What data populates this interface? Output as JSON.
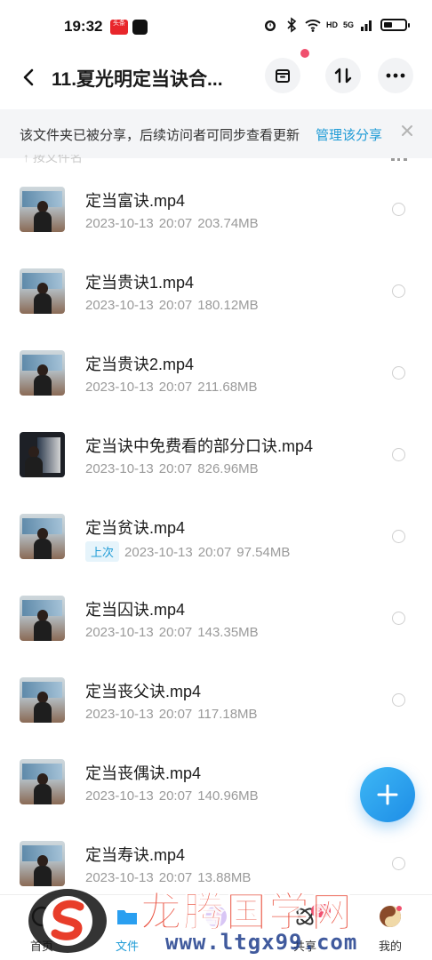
{
  "status_bar": {
    "time": "19:32",
    "app_badge": "头条",
    "network_label": "5G",
    "hd_label": "HD"
  },
  "header": {
    "title": "11.夏光明定当诀合...",
    "back_icon": "arrow-left-icon",
    "actions": [
      {
        "name": "archive-button",
        "icon": "archive-icon"
      },
      {
        "name": "sort-button",
        "icon": "sort-icon"
      },
      {
        "name": "more-button",
        "icon": "more-horizontal-icon"
      }
    ]
  },
  "share_notice": {
    "text": "该文件夹已被分享，后续访问者可同步查看更新",
    "link": "管理该分享",
    "close_icon": "close-icon"
  },
  "sort_hint": "↑ 按文件名",
  "files": [
    {
      "name": "定当富诀.mp4",
      "date": "2023-10-13",
      "time": "20:07",
      "size": "203.74MB",
      "tag": ""
    },
    {
      "name": "定当贵诀1.mp4",
      "date": "2023-10-13",
      "time": "20:07",
      "size": "180.12MB",
      "tag": ""
    },
    {
      "name": "定当贵诀2.mp4",
      "date": "2023-10-13",
      "time": "20:07",
      "size": "211.68MB",
      "tag": ""
    },
    {
      "name": "定当诀中免费看的部分口诀.mp4",
      "date": "2023-10-13",
      "time": "20:07",
      "size": "826.96MB",
      "tag": ""
    },
    {
      "name": "定当贫诀.mp4",
      "date": "2023-10-13",
      "time": "20:07",
      "size": "97.54MB",
      "tag": "上次"
    },
    {
      "name": "定当囚诀.mp4",
      "date": "2023-10-13",
      "time": "20:07",
      "size": "143.35MB",
      "tag": ""
    },
    {
      "name": "定当丧父诀.mp4",
      "date": "2023-10-13",
      "time": "20:07",
      "size": "117.18MB",
      "tag": ""
    },
    {
      "name": "定当丧偶诀.mp4",
      "date": "2023-10-13",
      "time": "20:07",
      "size": "140.96MB",
      "tag": ""
    },
    {
      "name": "定当寿诀.mp4",
      "date": "2023-10-13",
      "time": "20:07",
      "size": "13.88MB",
      "tag": ""
    }
  ],
  "fab": {
    "icon": "plus-icon"
  },
  "bottom_nav": [
    {
      "label": "首页",
      "icon": "home-icon",
      "active": false
    },
    {
      "label": "文件",
      "icon": "folder-icon",
      "active": true
    },
    {
      "label": "",
      "icon": "center-app-icon",
      "active": false
    },
    {
      "label": "共享",
      "icon": "share-icon",
      "active": false,
      "badge": "34"
    },
    {
      "label": "我的",
      "icon": "profile-icon",
      "active": false
    }
  ],
  "watermark": {
    "title": "龙腾国学网",
    "url": "www.ltgx99.com"
  },
  "colors": {
    "accent": "#1e9bd6",
    "fab": "#2a9ff0",
    "badge": "#f0506e",
    "watermark_red": "#e83d2a",
    "watermark_blue": "#1f3e8c"
  }
}
